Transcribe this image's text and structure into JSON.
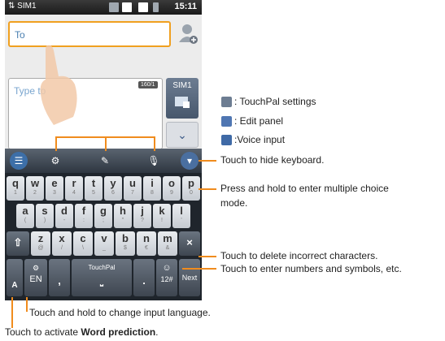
{
  "status": {
    "sim": "SIM1",
    "time": "15:11"
  },
  "message": {
    "to_placeholder": "To",
    "type_placeholder": "Type to",
    "counter": "160/1",
    "sim_button": "SIM1",
    "down_arrow": "⌄"
  },
  "keyboard": {
    "row1": [
      [
        "q",
        "1"
      ],
      [
        "w",
        "2"
      ],
      [
        "e",
        "3"
      ],
      [
        "r",
        "4"
      ],
      [
        "t",
        "5"
      ],
      [
        "y",
        "6"
      ],
      [
        "u",
        "7"
      ],
      [
        "i",
        "8"
      ],
      [
        "o",
        "9"
      ],
      [
        "p",
        "0"
      ]
    ],
    "row2": [
      [
        "a",
        "("
      ],
      [
        "s",
        ")"
      ],
      [
        "d",
        "-"
      ],
      [
        "f",
        ":"
      ],
      [
        "g",
        ";"
      ],
      [
        "h",
        "\""
      ],
      [
        "j",
        "?"
      ],
      [
        "k",
        "!"
      ],
      [
        "l",
        "'"
      ]
    ],
    "row3": [
      [
        "z",
        "@"
      ],
      [
        "x",
        "/"
      ],
      [
        "c",
        "\\"
      ],
      [
        "v",
        "_"
      ],
      [
        "b",
        "$"
      ],
      [
        "n",
        "€"
      ],
      [
        "m",
        "&"
      ]
    ],
    "shift": "⇧",
    "delete": "×",
    "lang": "EN",
    "comma": ",",
    "space_label": "TouchPal",
    "period": ".",
    "numbers": "12#",
    "next": "Next",
    "word_prediction_glyph": "A"
  },
  "legend": {
    "settings": ": TouchPal settings",
    "edit": ": Edit panel",
    "voice": ":Voice input"
  },
  "annotations": {
    "hide": "Touch to hide keyboard.",
    "press_hold_1": "Press and hold to enter multiple choice",
    "press_hold_2": "mode.",
    "delete": "Touch to delete incorrect characters.",
    "numbers": "Touch to enter numbers and symbols, etc.",
    "language": "Touch and hold to change input language.",
    "word_pred_prefix": "Touch to activate ",
    "word_pred_bold": "Word prediction",
    "word_pred_suffix": "."
  },
  "colors": {
    "accent": "#f08c1e",
    "link": "#4a7fb0"
  }
}
